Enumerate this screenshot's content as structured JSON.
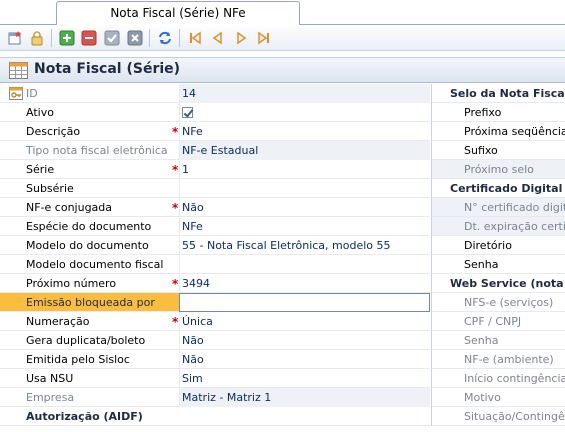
{
  "tab": {
    "label": "Nota Fiscal (Série) NFe"
  },
  "toolbar": {
    "buttons": [
      "new-icon",
      "lock-icon",
      "add-icon",
      "remove-icon",
      "confirm-icon",
      "cancel-icon",
      "refresh-icon",
      "first-icon",
      "previous-icon",
      "next-icon",
      "last-icon"
    ]
  },
  "form": {
    "title": "Nota Fiscal (Série)",
    "rows": [
      {
        "label": "ID",
        "value": "14"
      },
      {
        "label": "Ativo",
        "value": ""
      },
      {
        "label": "Descrição",
        "value": "NFe"
      },
      {
        "label": "Tipo nota fiscal eletrônica",
        "value": "NF-e Estadual"
      },
      {
        "label": "Série",
        "value": "1"
      },
      {
        "label": "Subsérie",
        "value": ""
      },
      {
        "label": "NF-e conjugada",
        "value": "Não"
      },
      {
        "label": "Espécie do documento",
        "value": "NFe"
      },
      {
        "label": "Modelo do documento",
        "value": "55 - Nota Fiscal Eletrônica, modelo 55"
      },
      {
        "label": "Modelo documento fiscal",
        "value": ""
      },
      {
        "label": "Próximo número",
        "value": "3494"
      },
      {
        "label": "Emissão bloqueada por",
        "value": ""
      },
      {
        "label": "Numeração",
        "value": "Única"
      },
      {
        "label": "Gera duplicata/boleto",
        "value": "Não"
      },
      {
        "label": "Emitida pelo Sisloc",
        "value": "Não"
      },
      {
        "label": "Usa NSU",
        "value": "Sim"
      },
      {
        "label": "Empresa",
        "value": "Matriz - Matriz 1"
      },
      {
        "label": "Autorização (AIDF)",
        "value": ""
      }
    ],
    "required_mark": "*"
  },
  "right_panel": {
    "rows": [
      {
        "type": "hdr",
        "text": "Selo da Nota Fiscal"
      },
      {
        "type": "item",
        "text": "Prefixo"
      },
      {
        "type": "item",
        "text": "Próxima seqüência"
      },
      {
        "type": "item",
        "text": "Sufixo"
      },
      {
        "type": "item",
        "text": "Próximo selo"
      },
      {
        "type": "hdr",
        "text": "Certificado Digital"
      },
      {
        "type": "item",
        "text": "N° certificado digital"
      },
      {
        "type": "item",
        "text": "Dt. expiração certificado"
      },
      {
        "type": "item",
        "text": "Diretório"
      },
      {
        "type": "item",
        "text": "Senha"
      },
      {
        "type": "hdr",
        "text": "Web Service (nota fiscal)"
      },
      {
        "type": "item",
        "text": "NFS-e (serviços)"
      },
      {
        "type": "item",
        "text": "CPF / CNPJ"
      },
      {
        "type": "item",
        "text": "Senha"
      },
      {
        "type": "item",
        "text": "NF-e (ambiente)"
      },
      {
        "type": "item",
        "text": "Início contingência"
      },
      {
        "type": "item",
        "text": "Motivo"
      },
      {
        "type": "item",
        "text": "Situação/Contingência"
      }
    ]
  },
  "colors": {
    "highlight": "#fbbd3d",
    "required": "#cc0000",
    "title": "#1f2a44"
  }
}
